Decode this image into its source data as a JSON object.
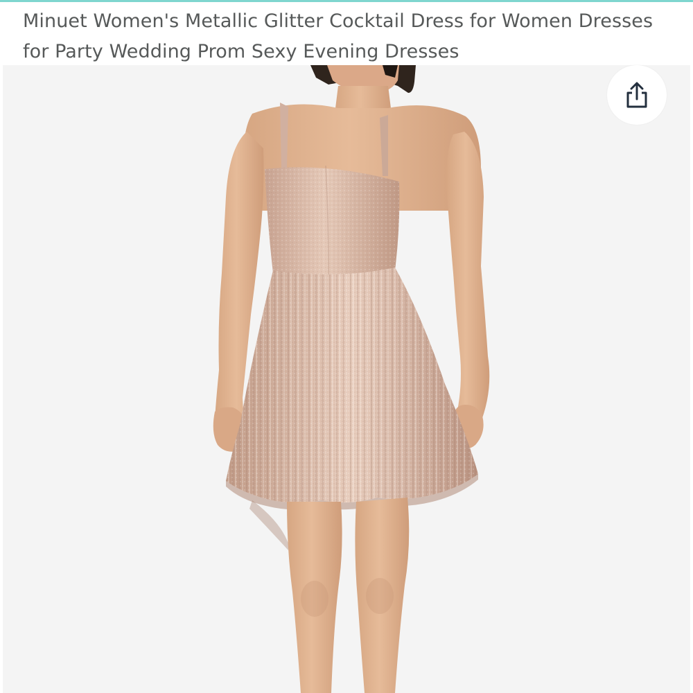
{
  "product": {
    "title": "Minuet Women's Metallic Glitter Cocktail Dress for Women Dresses for Party Wedding Prom Sexy Evening Dresses"
  },
  "image": {
    "alt": "Model wearing a rose-gold metallic glitter pleated cocktail dress"
  },
  "share": {
    "icon": "share-icon",
    "label": "Share"
  },
  "colors": {
    "accent": "#7fd6cf",
    "title_text": "#565959",
    "image_background": "#f4f4f4",
    "dress": "#d9b9a6",
    "skin": "#e3b592",
    "hair": "#2f241d"
  }
}
